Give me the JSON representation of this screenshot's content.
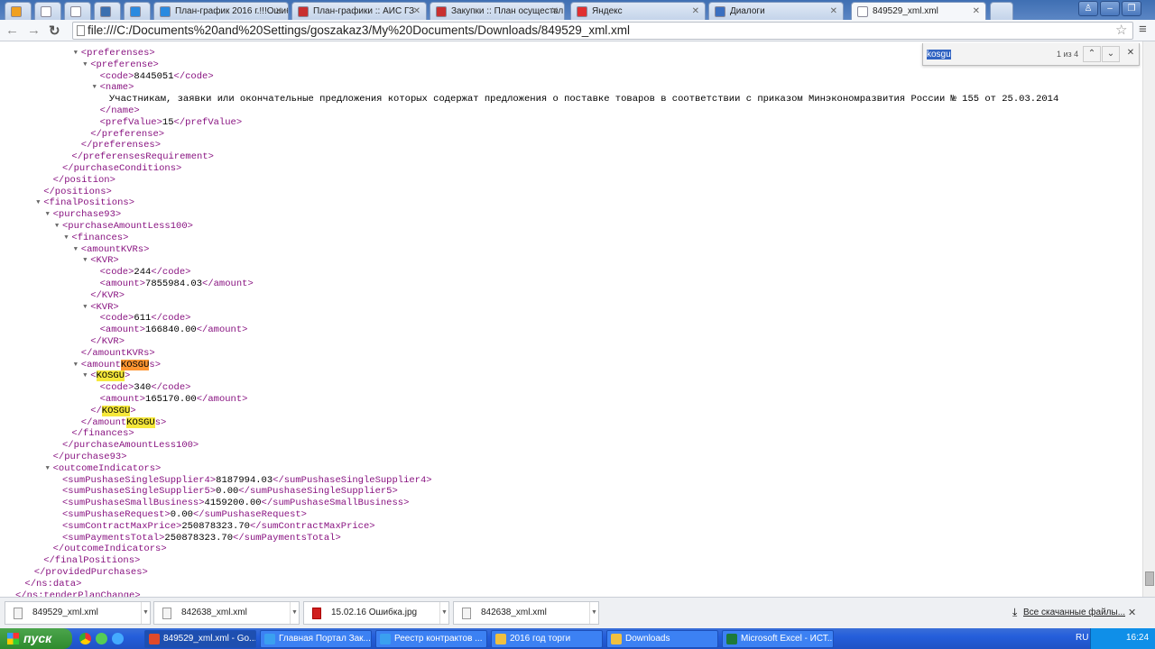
{
  "tabs": [
    {
      "label": "",
      "icon": "orange-circle-icon"
    },
    {
      "label": "",
      "icon": "mail-icon"
    },
    {
      "label": "",
      "icon": "page-icon"
    },
    {
      "label": "",
      "icon": "inc-icon"
    },
    {
      "label": "",
      "icon": "help-icon"
    },
    {
      "label": "План-график 2016 г.!!!Ошибка",
      "icon": "help-icon"
    },
    {
      "label": "План-графики :: АИС ГЗ",
      "icon": "ais-icon"
    },
    {
      "label": "Закупки :: План осуществл",
      "icon": "ais-icon"
    },
    {
      "label": "Яндекс",
      "icon": "yandex-icon"
    },
    {
      "label": "Диалоги",
      "icon": "dialog-icon"
    },
    {
      "label": "849529_xml.xml",
      "icon": "page-icon",
      "active": true
    }
  ],
  "address": "file:///C:/Documents%20and%20Settings/goszakaz3/My%20Documents/Downloads/849529_xml.xml",
  "find": {
    "query": "kosgu",
    "count": "1 из 4"
  },
  "xml_lines": [
    {
      "i": 7,
      "t": 1,
      "s": [
        [
          "t",
          "<preferenses>"
        ]
      ]
    },
    {
      "i": 8,
      "t": 1,
      "s": [
        [
          "t",
          "<preferense>"
        ]
      ]
    },
    {
      "i": 9,
      "s": [
        [
          "t",
          "<code>"
        ],
        [
          "x",
          "8445051"
        ],
        [
          "t",
          "</code>"
        ]
      ]
    },
    {
      "i": 9,
      "t": 1,
      "s": [
        [
          "t",
          "<name>"
        ]
      ]
    },
    {
      "i": 10,
      "s": [
        [
          "x",
          "Участникам, заявки или окончательные предложения которых содержат предложения о поставке товаров в соответствии с приказом Минэкономразвития России № 155 от 25.03.2014"
        ]
      ]
    },
    {
      "i": 9,
      "s": [
        [
          "t",
          "</name>"
        ]
      ]
    },
    {
      "i": 9,
      "s": [
        [
          "t",
          "<prefValue>"
        ],
        [
          "x",
          "15"
        ],
        [
          "t",
          "</prefValue>"
        ]
      ]
    },
    {
      "i": 8,
      "s": [
        [
          "t",
          "</preferense>"
        ]
      ]
    },
    {
      "i": 7,
      "s": [
        [
          "t",
          "</preferenses>"
        ]
      ]
    },
    {
      "i": 6,
      "s": [
        [
          "t",
          "</preferensesRequirement>"
        ]
      ]
    },
    {
      "i": 5,
      "s": [
        [
          "t",
          "</purchaseConditions>"
        ]
      ]
    },
    {
      "i": 4,
      "s": [
        [
          "t",
          "</position>"
        ]
      ]
    },
    {
      "i": 3,
      "s": [
        [
          "t",
          "</positions>"
        ]
      ]
    },
    {
      "i": 3,
      "t": 1,
      "s": [
        [
          "t",
          "<finalPositions>"
        ]
      ]
    },
    {
      "i": 4,
      "t": 1,
      "s": [
        [
          "t",
          "<purchase93>"
        ]
      ]
    },
    {
      "i": 5,
      "t": 1,
      "s": [
        [
          "t",
          "<purchaseAmountLess100>"
        ]
      ]
    },
    {
      "i": 6,
      "t": 1,
      "s": [
        [
          "t",
          "<finances>"
        ]
      ]
    },
    {
      "i": 7,
      "t": 1,
      "s": [
        [
          "t",
          "<amountKVRs>"
        ]
      ]
    },
    {
      "i": 8,
      "t": 1,
      "s": [
        [
          "t",
          "<KVR>"
        ]
      ]
    },
    {
      "i": 9,
      "s": [
        [
          "t",
          "<code>"
        ],
        [
          "x",
          "244"
        ],
        [
          "t",
          "</code>"
        ]
      ]
    },
    {
      "i": 9,
      "s": [
        [
          "t",
          "<amount>"
        ],
        [
          "x",
          "7855984.03"
        ],
        [
          "t",
          "</amount>"
        ]
      ]
    },
    {
      "i": 8,
      "s": [
        [
          "t",
          "</KVR>"
        ]
      ]
    },
    {
      "i": 8,
      "t": 1,
      "s": [
        [
          "t",
          "<KVR>"
        ]
      ]
    },
    {
      "i": 9,
      "s": [
        [
          "t",
          "<code>"
        ],
        [
          "x",
          "611"
        ],
        [
          "t",
          "</code>"
        ]
      ]
    },
    {
      "i": 9,
      "s": [
        [
          "t",
          "<amount>"
        ],
        [
          "x",
          "166840.00"
        ],
        [
          "t",
          "</amount>"
        ]
      ]
    },
    {
      "i": 8,
      "s": [
        [
          "t",
          "</KVR>"
        ]
      ]
    },
    {
      "i": 7,
      "s": [
        [
          "t",
          "</amountKVRs>"
        ]
      ]
    },
    {
      "i": 7,
      "t": 1,
      "s": [
        [
          "t",
          "<amount"
        ],
        [
          "a",
          "KOSGU"
        ],
        [
          "t",
          "s>"
        ]
      ]
    },
    {
      "i": 8,
      "t": 1,
      "s": [
        [
          "t",
          "<"
        ],
        [
          "h",
          "KOSGU"
        ],
        [
          "t",
          ">"
        ]
      ]
    },
    {
      "i": 9,
      "s": [
        [
          "t",
          "<code>"
        ],
        [
          "x",
          "340"
        ],
        [
          "t",
          "</code>"
        ]
      ]
    },
    {
      "i": 9,
      "s": [
        [
          "t",
          "<amount>"
        ],
        [
          "x",
          "165170.00"
        ],
        [
          "t",
          "</amount>"
        ]
      ]
    },
    {
      "i": 8,
      "s": [
        [
          "t",
          "</"
        ],
        [
          "h",
          "KOSGU"
        ],
        [
          "t",
          ">"
        ]
      ]
    },
    {
      "i": 7,
      "s": [
        [
          "t",
          "</amount"
        ],
        [
          "h",
          "KOSGU"
        ],
        [
          "t",
          "s>"
        ]
      ]
    },
    {
      "i": 6,
      "s": [
        [
          "t",
          "</finances>"
        ]
      ]
    },
    {
      "i": 5,
      "s": [
        [
          "t",
          "</purchaseAmountLess100>"
        ]
      ]
    },
    {
      "i": 4,
      "s": [
        [
          "t",
          "</purchase93>"
        ]
      ]
    },
    {
      "i": 4,
      "t": 1,
      "s": [
        [
          "t",
          "<outcomeIndicators>"
        ]
      ]
    },
    {
      "i": 5,
      "s": [
        [
          "t",
          "<sumPushaseSingleSupplier4>"
        ],
        [
          "x",
          "8187994.03"
        ],
        [
          "t",
          "</sumPushaseSingleSupplier4>"
        ]
      ]
    },
    {
      "i": 5,
      "s": [
        [
          "t",
          "<sumPushaseSingleSupplier5>"
        ],
        [
          "x",
          "0.00"
        ],
        [
          "t",
          "</sumPushaseSingleSupplier5>"
        ]
      ]
    },
    {
      "i": 5,
      "s": [
        [
          "t",
          "<sumPushaseSmallBusiness>"
        ],
        [
          "x",
          "4159200.00"
        ],
        [
          "t",
          "</sumPushaseSmallBusiness>"
        ]
      ]
    },
    {
      "i": 5,
      "s": [
        [
          "t",
          "<sumPushaseRequest>"
        ],
        [
          "x",
          "0.00"
        ],
        [
          "t",
          "</sumPushaseRequest>"
        ]
      ]
    },
    {
      "i": 5,
      "s": [
        [
          "t",
          "<sumContractMaxPrice>"
        ],
        [
          "x",
          "250878323.70"
        ],
        [
          "t",
          "</sumContractMaxPrice>"
        ]
      ]
    },
    {
      "i": 5,
      "s": [
        [
          "t",
          "<sumPaymentsTotal>"
        ],
        [
          "x",
          "250878323.70"
        ],
        [
          "t",
          "</sumPaymentsTotal>"
        ]
      ]
    },
    {
      "i": 4,
      "s": [
        [
          "t",
          "</outcomeIndicators>"
        ]
      ]
    },
    {
      "i": 3,
      "s": [
        [
          "t",
          "</finalPositions>"
        ]
      ]
    },
    {
      "i": 2,
      "s": [
        [
          "t",
          "</providedPurchases>"
        ]
      ]
    },
    {
      "i": 1,
      "s": [
        [
          "t",
          "</ns:data>"
        ]
      ]
    },
    {
      "i": 0,
      "s": [
        [
          "t",
          "</ns:tenderPlanChange>"
        ]
      ]
    }
  ],
  "downloads": [
    {
      "name": "849529_xml.xml",
      "type": "xml"
    },
    {
      "name": "842638_xml.xml",
      "type": "xml"
    },
    {
      "name": "15.02.16 Ошибка.jpg",
      "type": "jpg"
    },
    {
      "name": "842638_xml.xml",
      "type": "xml"
    }
  ],
  "all_downloads": "Все скачанные файлы...",
  "taskbar": {
    "start": "пуск",
    "tasks": [
      {
        "label": "849529_xml.xml - Go...",
        "active": true,
        "color": "#e04a2a"
      },
      {
        "label": "Главная Портал Зак...",
        "color": "#3aa0f0"
      },
      {
        "label": "Реестр контрактов ...",
        "color": "#3aa0f0"
      },
      {
        "label": "2016 год торги",
        "color": "#f0c040"
      },
      {
        "label": "Downloads",
        "color": "#f0c040"
      },
      {
        "label": "Microsoft Excel - ИСТ...",
        "color": "#1d7a3a"
      }
    ],
    "lang": "RU",
    "clock": "16:24"
  }
}
